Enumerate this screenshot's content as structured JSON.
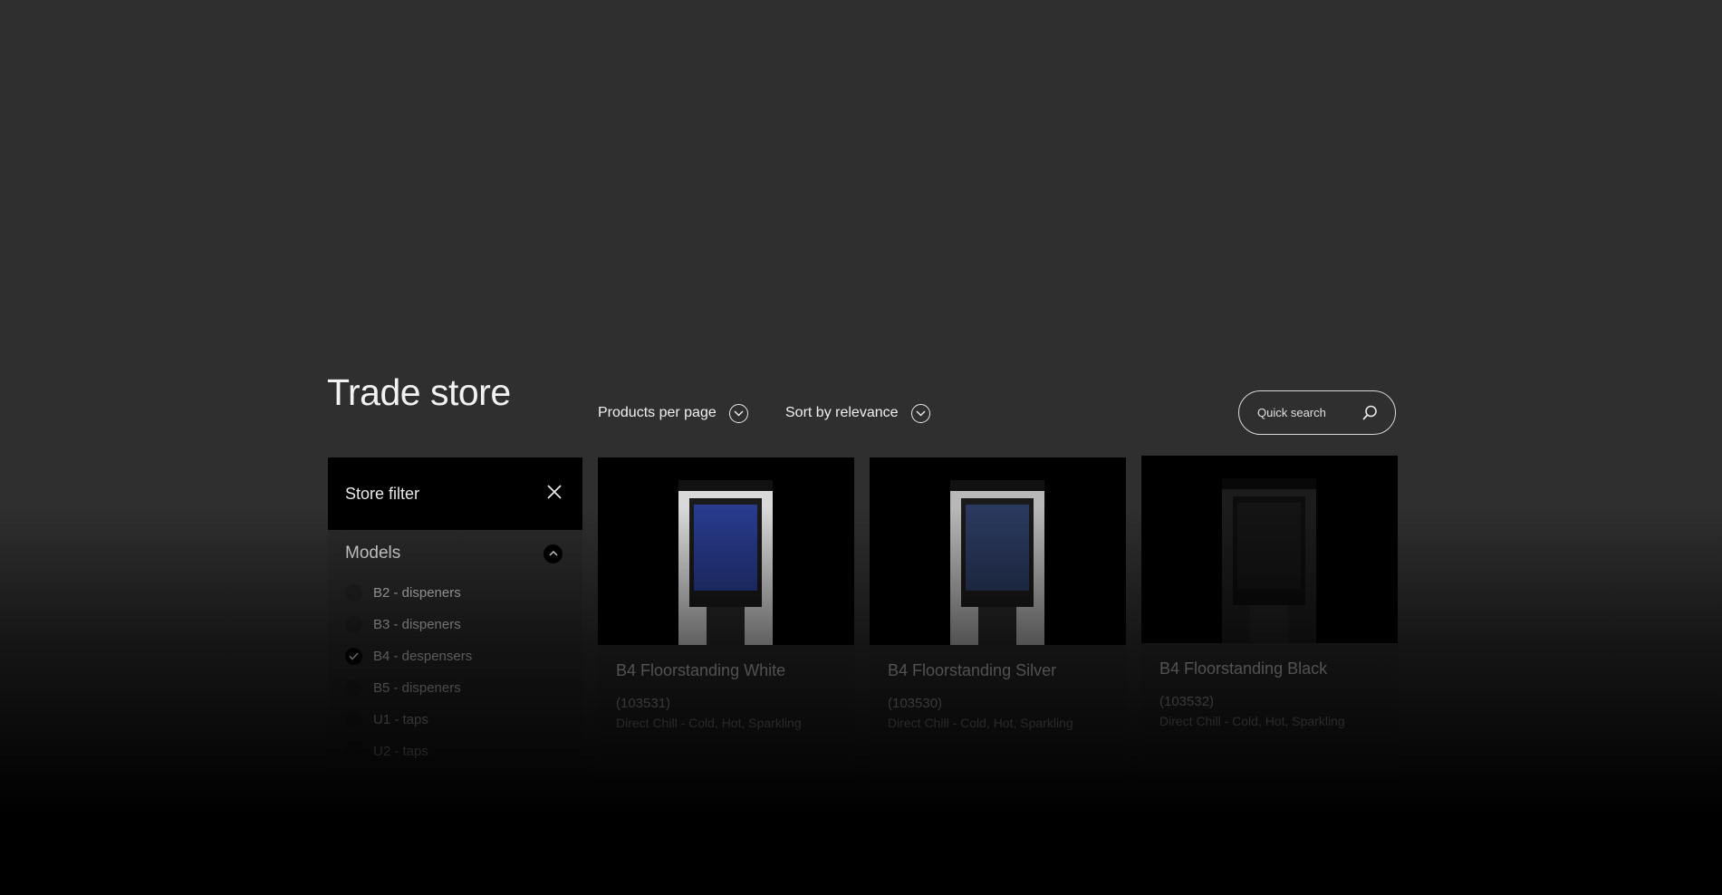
{
  "page": {
    "title": "Trade store"
  },
  "toolbar": {
    "per_page_label": "Products per page",
    "sort_label": "Sort by relevance",
    "search_placeholder": "Quick search"
  },
  "filter": {
    "title": "Store filter",
    "section_title": "Models",
    "options": [
      {
        "label": "B2 - dispeners",
        "checked": false
      },
      {
        "label": "B3 - dispeners",
        "checked": false
      },
      {
        "label": "B4 - despensers",
        "checked": true
      },
      {
        "label": "B5 - dispeners",
        "checked": false
      },
      {
        "label": "U1 - taps",
        "checked": false
      },
      {
        "label": "U2 - taps",
        "checked": false
      }
    ]
  },
  "products": [
    {
      "name": "B4 Floorstanding White",
      "code": "(103531)",
      "desc": "Direct Chill - Cold, Hot, Sparkling",
      "color": "#d9d9d9"
    },
    {
      "name": "B4 Floorstanding Silver",
      "code": "(103530)",
      "desc": "Direct Chill - Cold, Hot, Sparkling",
      "color": "#b8b8b8"
    },
    {
      "name": "B4 Floorstanding Black",
      "code": "(103532)",
      "desc": "Direct Chill - Cold, Hot, Sparkling",
      "color": "#1c1c1c"
    }
  ]
}
